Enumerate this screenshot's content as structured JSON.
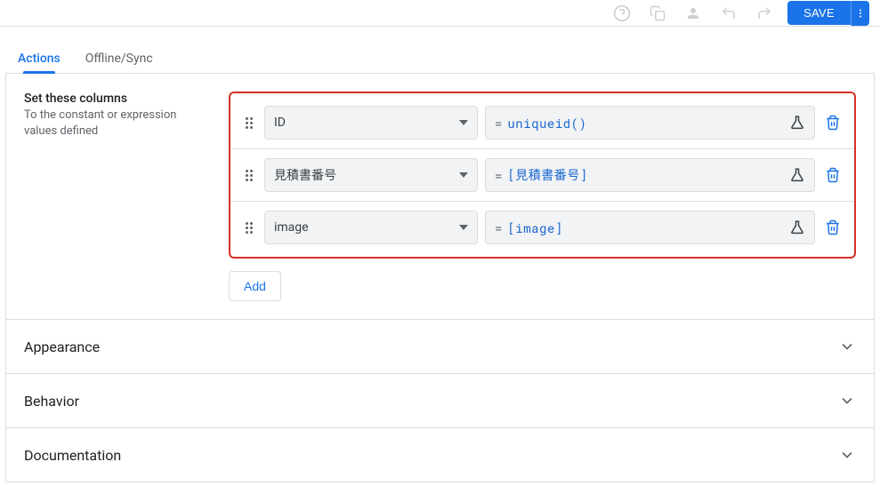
{
  "topbar": {
    "save_label": "SAVE"
  },
  "tabs": {
    "actions": "Actions",
    "offline_sync": "Offline/Sync"
  },
  "set_columns": {
    "title": "Set these columns",
    "desc": "To the constant or expression values defined",
    "rows": [
      {
        "column": "ID",
        "expression": "uniqueid()"
      },
      {
        "column": "見積書番号",
        "expression": "[見積書番号]"
      },
      {
        "column": "image",
        "expression": "[image]"
      }
    ],
    "add_label": "Add"
  },
  "sections": {
    "appearance": "Appearance",
    "behavior": "Behavior",
    "documentation": "Documentation"
  }
}
